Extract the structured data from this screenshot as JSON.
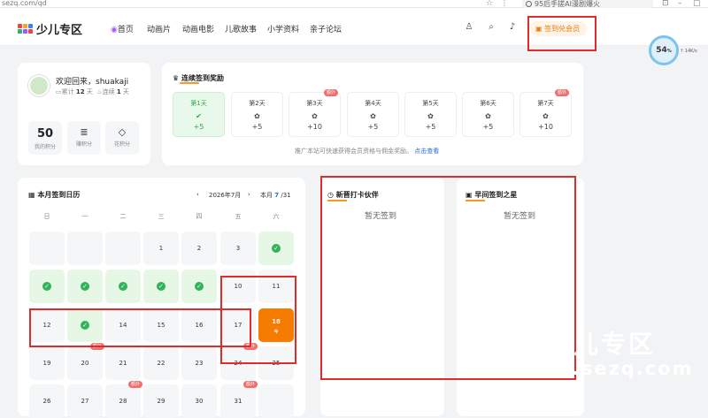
{
  "browser": {
    "url": "sezq.com/qd",
    "search_text": "95后手搓AI漫剧爆火"
  },
  "nav": {
    "logo_text": "少儿专区",
    "menu": [
      "首页",
      "动画片",
      "动画电影",
      "儿歌故事",
      "小学资料",
      "亲子论坛"
    ],
    "sign_button": "签到兑会员"
  },
  "gauge": {
    "percent": "54",
    "unit": "%",
    "speed": "↑ 14K/s"
  },
  "user": {
    "greeting": "欢迎回来，shuakaji",
    "total_label": "累计",
    "total_days": "12",
    "streak_label": "连续",
    "streak_days": "1",
    "day_unit": "天",
    "stats": [
      {
        "value": "50",
        "label": "我的积分"
      },
      {
        "icon": "coin-stack-icon",
        "label": "赚积分"
      },
      {
        "icon": "diamond-icon",
        "label": "花积分"
      }
    ]
  },
  "rewards": {
    "title": "连续签到奖励",
    "badge": "额外",
    "days": [
      {
        "label": "第1天",
        "reward": "+5",
        "done": true
      },
      {
        "label": "第2天",
        "reward": "+5",
        "done": false
      },
      {
        "label": "第3天",
        "reward": "+10",
        "done": false
      },
      {
        "label": "第4天",
        "reward": "+5",
        "done": false
      },
      {
        "label": "第5天",
        "reward": "+5",
        "done": false
      },
      {
        "label": "第6天",
        "reward": "+5",
        "done": false
      },
      {
        "label": "第7天",
        "reward": "+10",
        "done": false
      }
    ],
    "note": "推广本站可快速获得会员资格与佣金奖励。",
    "note_link": "点击查看"
  },
  "calendar": {
    "title": "本月签到日历",
    "month": "2026年7月",
    "progress_prefix": "本月",
    "progress_done": "7",
    "progress_total": "/31",
    "weekdays": [
      "日",
      "一",
      "二",
      "三",
      "四",
      "五",
      "六"
    ],
    "today_label": "今",
    "badge": "额外",
    "weeks": [
      [
        null,
        null,
        null,
        {
          "d": "1"
        },
        {
          "d": "2"
        },
        {
          "d": "3"
        },
        {
          "d": "4",
          "done": true
        }
      ],
      [
        {
          "d": "5",
          "done": true
        },
        {
          "d": "6",
          "done": true
        },
        {
          "d": "7",
          "done": true
        },
        {
          "d": "8",
          "done": true
        },
        {
          "d": "9",
          "done": true
        },
        {
          "d": "10"
        },
        {
          "d": "11"
        }
      ],
      [
        {
          "d": "12"
        },
        {
          "d": "13",
          "done": true
        },
        {
          "d": "14"
        },
        {
          "d": "15"
        },
        {
          "d": "16"
        },
        {
          "d": "17"
        },
        {
          "d": "18",
          "today": true
        }
      ],
      [
        {
          "d": "19"
        },
        {
          "d": "20"
        },
        {
          "d": "21"
        },
        {
          "d": "22"
        },
        {
          "d": "23"
        },
        {
          "d": "24"
        },
        {
          "d": "25"
        }
      ],
      [
        {
          "d": "26"
        },
        {
          "d": "27"
        },
        {
          "d": "28"
        },
        {
          "d": "29"
        },
        {
          "d": "30"
        },
        {
          "d": "31"
        },
        null
      ]
    ]
  },
  "panels": [
    {
      "title": "新晋打卡伙伴",
      "empty": "暂无签到"
    },
    {
      "title": "早间签到之星",
      "empty": "暂无签到"
    }
  ],
  "watermark": {
    "line1": "少儿专区",
    "line2": "www.sezq.com"
  },
  "colors": {
    "accent": "#f57c00",
    "done": "#2fb45a",
    "annotation": "#e02b2b"
  }
}
